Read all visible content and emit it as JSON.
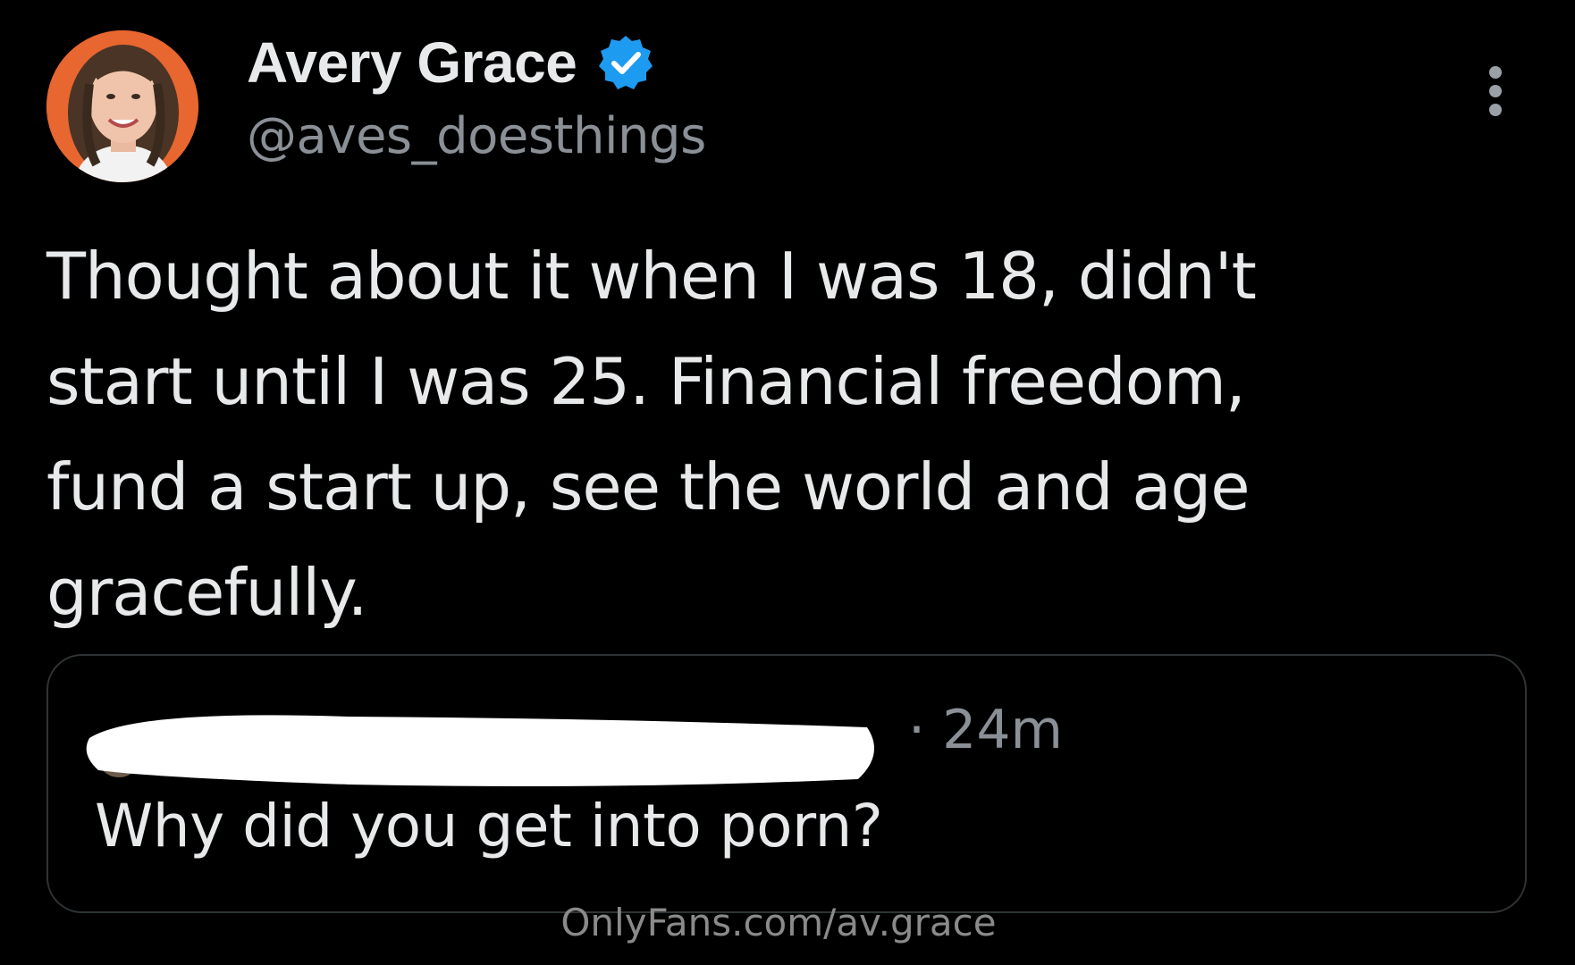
{
  "author": {
    "display_name": "Avery Grace",
    "handle": "@aves_doesthings",
    "verified": true,
    "avatar_icon": "profile-photo-icon",
    "verified_icon": "verified-badge-icon"
  },
  "tweet": {
    "text": "Thought about it when I was 18, didn't\nstart until I was 25. Financial freedom,\nfund a start up, see the world and age\ngracefully."
  },
  "quoted_tweet": {
    "meta": "· 24m",
    "text": "Why did you get into porn?"
  },
  "watermark": "OnlyFans.com/av.grace",
  "colors": {
    "background": "#000000",
    "primary_text": "#e7e9ea",
    "secondary_text": "#8b9096",
    "verified_blue": "#1d9bf0",
    "card_border": "#2f3336",
    "avatar_bg": "#e8662f"
  },
  "icons": {
    "more": "more-vertical-icon"
  }
}
